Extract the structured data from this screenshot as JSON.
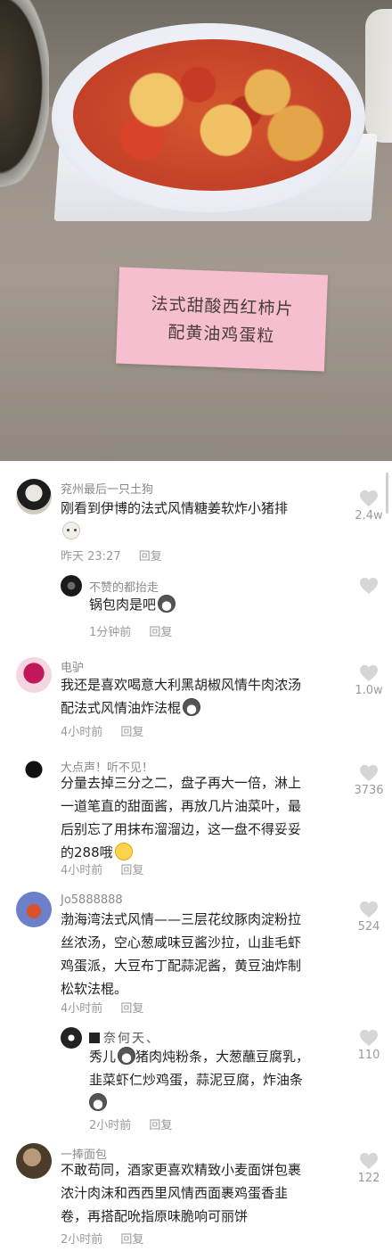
{
  "photo": {
    "sign_line1": "法式甜酸西红柿片",
    "sign_line2": "配黄油鸡蛋粒"
  },
  "comments": [
    {
      "username": "兖州最后一只土狗",
      "text_lines": [
        "刚看到伊博的法式风情糖姜软炸小猪排"
      ],
      "emoji": "cat-emoji",
      "time": "昨天 23:27",
      "reply_label": "回复",
      "likes": "2.4w",
      "replies": [
        {
          "username": "不赞的都抬走",
          "text_lines": [
            "锅包肉是吧"
          ],
          "emoji": "husky-emoji",
          "time": "1分钟前",
          "reply_label": "回复"
        }
      ]
    },
    {
      "username": "电驴",
      "text_lines": [
        "我还是喜欢喝意大利黑胡椒风情牛肉浓汤",
        "配法式风情油炸法棍"
      ],
      "emoji": "husky-emoji",
      "time": "4小时前",
      "reply_label": "回复",
      "likes": "1.0w"
    },
    {
      "username": "大点声！听不见！",
      "text_lines": [
        "分量去掉三分之二，盘子再大一倍，淋上",
        "一道笔直的甜面酱，再放几片油菜叶，最",
        "后别忘了用抹布溜溜边，这一盘不得妥妥",
        "的288哦"
      ],
      "emoji": "smile-emoji",
      "time": "4小时前",
      "reply_label": "回复",
      "likes": "3736"
    },
    {
      "username": "Jo5888888",
      "text_lines": [
        "渤海湾法式风情——三层花纹豚肉淀粉拉",
        "丝浓汤，空心葱咸味豆酱沙拉，山韭毛虾",
        "鸡蛋派，大豆布丁配蒜泥酱，黄豆油炸制",
        "松软法棍。"
      ],
      "time": "4小时前",
      "reply_label": "回复",
      "likes": "524",
      "replies": [
        {
          "username": "奈何天、",
          "text_lines": [
            "秀儿 猪肉炖粉条，大葱蘸豆腐乳，",
            "韭菜虾仁炒鸡蛋，蒜泥豆腐，炸油条"
          ],
          "emoji": "husky-emoji",
          "time": "2小时前",
          "reply_label": "回复",
          "likes": "110"
        }
      ]
    },
    {
      "username": "一捧面包",
      "text_lines": [
        "不敢苟同，酒家更喜欢精致小麦面饼包裹",
        "浓汁肉沫和西西里风情西面裹鸡蛋香韭",
        "卷，再搭配吮指原味脆响可丽饼"
      ],
      "time": "2小时前",
      "reply_label": "回复",
      "likes": "122"
    }
  ],
  "colors": {
    "username": "#8a8a8a",
    "text": "#222222",
    "meta": "#9a9a9a",
    "heart": "#d6d6d6",
    "sign": "#f6bfcf"
  }
}
